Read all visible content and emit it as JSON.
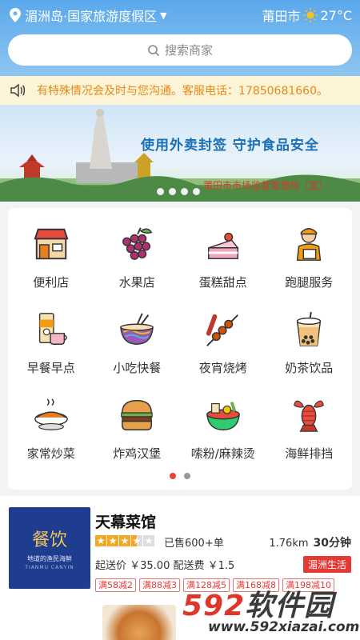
{
  "header": {
    "location": "湄洲岛·国家旅游度假区",
    "city": "莆田市",
    "temperature": "27°C"
  },
  "search": {
    "placeholder": "搜索商家"
  },
  "notice": {
    "text": "有特殊情况会及时与您沟通。客服电话：17850681660。"
  },
  "banner": {
    "slogan": "使用外卖封签 守护食品安全",
    "org": "莆田市市场监督管理局（宣）"
  },
  "categories": [
    {
      "label": "便利店",
      "icon": "store-icon"
    },
    {
      "label": "水果店",
      "icon": "grapes-icon"
    },
    {
      "label": "蛋糕甜点",
      "icon": "cake-icon"
    },
    {
      "label": "跑腿服务",
      "icon": "courier-icon"
    },
    {
      "label": "早餐早点",
      "icon": "tea-cup-icon"
    },
    {
      "label": "小吃快餐",
      "icon": "bowl-icon"
    },
    {
      "label": "夜宵烧烤",
      "icon": "skewer-icon"
    },
    {
      "label": "奶茶饮品",
      "icon": "bubble-tea-icon"
    },
    {
      "label": "家常炒菜",
      "icon": "dish-icon"
    },
    {
      "label": "炸鸡汉堡",
      "icon": "burger-icon"
    },
    {
      "label": "嗦粉/麻辣烫",
      "icon": "hotpot-icon"
    },
    {
      "label": "海鲜排挡",
      "icon": "lobster-icon"
    }
  ],
  "shop": {
    "name": "天幕菜馆",
    "logo_text": "餐饮",
    "logo_sub": "地道的渔民海鲜",
    "logo_en": "TIANMU CANYIN",
    "rating_stars": 3.5,
    "sold": "已售600+单",
    "distance": "1.76km",
    "time": "30分钟",
    "price_line": "起送价 ￥35.00  配送费 ￥1.5",
    "area_tag": "湄洲生活",
    "promos": [
      "满58减2",
      "满88减3",
      "满128减5",
      "满168减8",
      "满198减10"
    ]
  },
  "watermark": {
    "brand_num": "592",
    "brand_text": "软件园",
    "url": "www.592xiazai.com"
  },
  "colors": {
    "accent": "#e53935",
    "header": "#5aa8ec",
    "notice": "#e38b1b"
  }
}
